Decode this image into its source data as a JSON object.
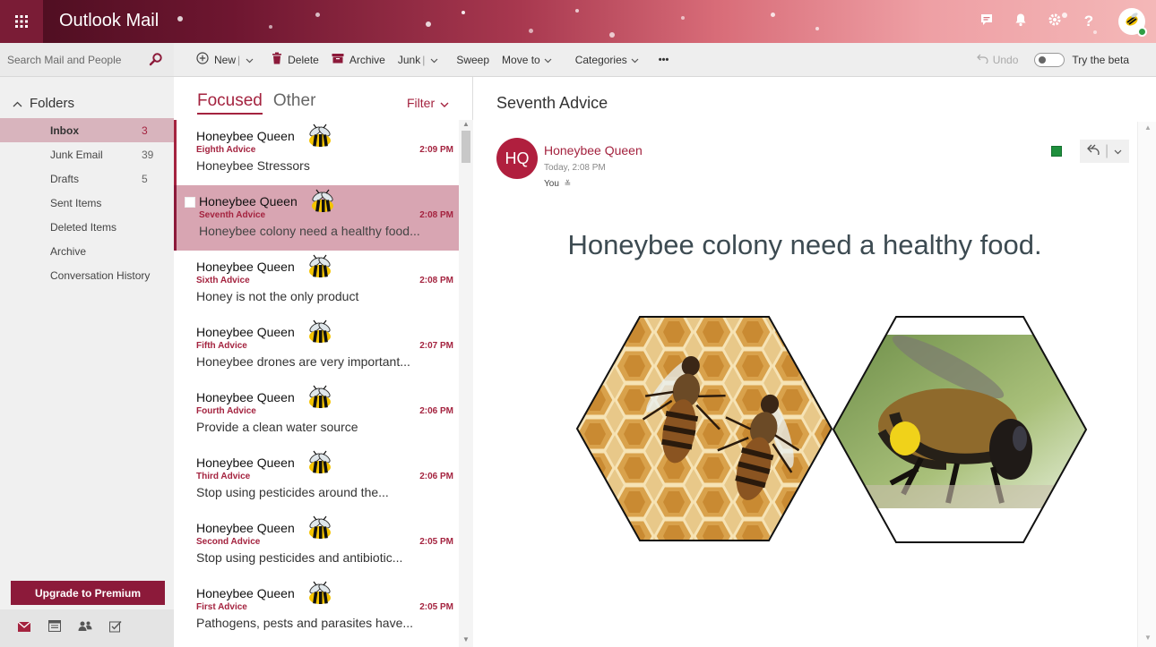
{
  "app": {
    "title": "Outlook Mail"
  },
  "search": {
    "placeholder": "Search Mail and People"
  },
  "toolbar": {
    "new_label": "New",
    "delete_label": "Delete",
    "archive_label": "Archive",
    "junk_label": "Junk",
    "sweep_label": "Sweep",
    "moveto_label": "Move to",
    "categories_label": "Categories",
    "more_label": "•••",
    "undo_label": "Undo",
    "beta_label": "Try the beta"
  },
  "sidebar": {
    "folders_label": "Folders",
    "items": [
      {
        "label": "Inbox",
        "count": "3"
      },
      {
        "label": "Junk Email",
        "count": "39"
      },
      {
        "label": "Drafts",
        "count": "5"
      },
      {
        "label": "Sent Items",
        "count": ""
      },
      {
        "label": "Deleted Items",
        "count": ""
      },
      {
        "label": "Archive",
        "count": ""
      },
      {
        "label": "Conversation History",
        "count": ""
      }
    ],
    "premium_label": "Upgrade to Premium"
  },
  "list": {
    "tab_focused": "Focused",
    "tab_other": "Other",
    "filter_label": "Filter",
    "messages": [
      {
        "sender": "Honeybee Queen",
        "subject": "Eighth Advice",
        "time": "2:09 PM",
        "preview": "Honeybee Stressors"
      },
      {
        "sender": "Honeybee Queen",
        "subject": "Seventh Advice",
        "time": "2:08 PM",
        "preview": "Honeybee colony need a healthy food..."
      },
      {
        "sender": "Honeybee Queen",
        "subject": "Sixth Advice",
        "time": "2:08 PM",
        "preview": "Honey is not the only product"
      },
      {
        "sender": "Honeybee Queen",
        "subject": "Fifth Advice",
        "time": "2:07 PM",
        "preview": "Honeybee drones are very important..."
      },
      {
        "sender": "Honeybee Queen",
        "subject": "Fourth Advice",
        "time": "2:06 PM",
        "preview": "Provide a clean water source"
      },
      {
        "sender": "Honeybee Queen",
        "subject": "Third Advice",
        "time": "2:06 PM",
        "preview": "Stop using pesticides around the..."
      },
      {
        "sender": "Honeybee Queen",
        "subject": "Second Advice",
        "time": "2:05 PM",
        "preview": "Stop using pesticides and antibiotic..."
      },
      {
        "sender": "Honeybee Queen",
        "subject": "First Advice",
        "time": "2:05 PM",
        "preview": "Pathogens, pests and parasites have..."
      }
    ]
  },
  "reading": {
    "subject": "Seventh Advice",
    "avatar_initials": "HQ",
    "from": "Honeybee Queen",
    "date": "Today, 2:08 PM",
    "to": "You",
    "body_heading": "Honeybee colony need a healthy food."
  },
  "colors": {
    "accent": "#a4233f",
    "selected_item": "#d8a5b2",
    "premium": "#8c1a3a"
  },
  "icons": {
    "waffle": "waffle-icon",
    "search": "search-icon",
    "bee": "bee-icon"
  }
}
